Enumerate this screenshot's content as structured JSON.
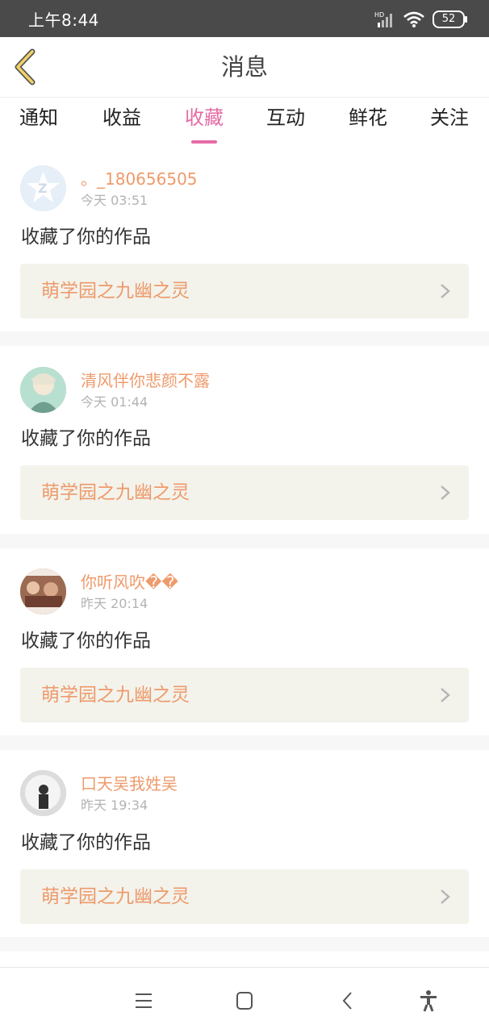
{
  "status_bar": {
    "time": "上午8:44",
    "battery": "52",
    "icons": [
      "hd-signal-icon",
      "wifi-icon",
      "battery-icon"
    ]
  },
  "header": {
    "title": "消息"
  },
  "tabs": [
    {
      "label": "通知",
      "active": false
    },
    {
      "label": "收益",
      "active": false
    },
    {
      "label": "收藏",
      "active": true
    },
    {
      "label": "互动",
      "active": false
    },
    {
      "label": "鲜花",
      "active": false
    },
    {
      "label": "关注",
      "active": false
    }
  ],
  "feed": [
    {
      "username": "。_180656505",
      "time": "今天 03:51",
      "action": "收藏了你的作品",
      "work_title": "萌学园之九幽之灵"
    },
    {
      "username": "清风伴你悲颜不露",
      "time": "今天 01:44",
      "action": "收藏了你的作品",
      "work_title": "萌学园之九幽之灵"
    },
    {
      "username": "你听风吹��",
      "time": "昨天 20:14",
      "action": "收藏了你的作品",
      "work_title": "萌学园之九幽之灵"
    },
    {
      "username": "口天吴我姓吴",
      "time": "昨天 19:34",
      "action": "收藏了你的作品",
      "work_title": "萌学园之九幽之灵"
    }
  ],
  "colors": {
    "accent_pink": "#e56ba5",
    "username_orange": "#ee9a6b",
    "card_bg": "#f3f3ec"
  }
}
